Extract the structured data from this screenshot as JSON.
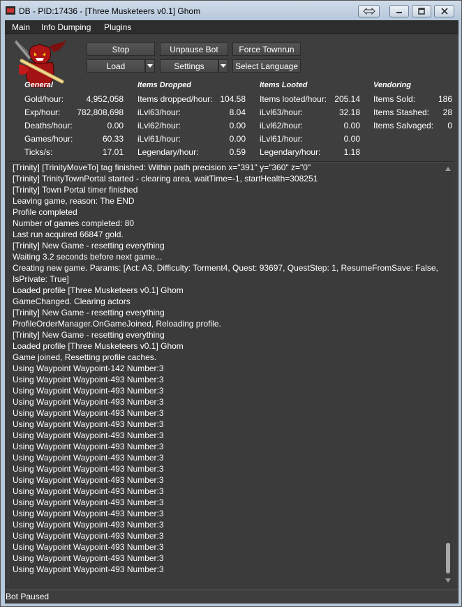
{
  "window": {
    "title": "DB - PID:17436 - [Three Musketeers v0.1] Ghom"
  },
  "menu": {
    "items": [
      "Main",
      "Info Dumping",
      "Plugins"
    ]
  },
  "buttons": {
    "stop": "Stop",
    "unpause": "Unpause Bot",
    "townrun": "Force Townrun",
    "load": "Load",
    "settings": "Settings",
    "language": "Select Language"
  },
  "stats": {
    "general": {
      "title": "General",
      "rows": [
        {
          "label": "Gold/hour:",
          "value": "4,952,058"
        },
        {
          "label": "Exp/hour:",
          "value": "782,808,698"
        },
        {
          "label": "Deaths/hour:",
          "value": "0.00"
        },
        {
          "label": "Games/hour:",
          "value": "60.33"
        },
        {
          "label": "Ticks/s:",
          "value": "17.01"
        }
      ]
    },
    "dropped": {
      "title": "Items Dropped",
      "rows": [
        {
          "label": "Items dropped/hour:",
          "value": "104.58"
        },
        {
          "label": "iLvl63/hour:",
          "value": "8.04"
        },
        {
          "label": "iLvl62/hour:",
          "value": "0.00"
        },
        {
          "label": "iLvl61/hour:",
          "value": "0.00"
        },
        {
          "label": "Legendary/hour:",
          "value": "0.59"
        }
      ]
    },
    "looted": {
      "title": "Items Looted",
      "rows": [
        {
          "label": "Items looted/hour:",
          "value": "205.14"
        },
        {
          "label": "iLvl63/hour:",
          "value": "32.18"
        },
        {
          "label": "iLvl62/hour:",
          "value": "0.00"
        },
        {
          "label": "iLvl61/hour:",
          "value": "0.00"
        },
        {
          "label": "Legendary/hour:",
          "value": "1.18"
        }
      ]
    },
    "vendoring": {
      "title": "Vendoring",
      "rows": [
        {
          "label": "Items Sold:",
          "value": "186"
        },
        {
          "label": "Items Stashed:",
          "value": "28"
        },
        {
          "label": "Items Salvaged:",
          "value": "0"
        }
      ]
    }
  },
  "log": [
    "[Trinity] [TrinityMoveTo] tag finished: Within path precision x=\"391\" y=\"360\" z=\"0\"",
    "[Trinity] TrinityTownPortal started - clearing area, waitTime=-1, startHealth=308251",
    "[Trinity] Town Portal timer finished",
    "Leaving game, reason: The END",
    "Profile completed",
    "Number of games completed: 80",
    "Last run acquired 66847 gold.",
    "[Trinity] New Game - resetting everything",
    "Waiting 3.2 seconds before next game...",
    "Creating new game. Params: [Act: A3, Difficulty: Torment4, Quest: 93697, QuestStep: 1, ResumeFromSave: False, IsPrivate: True]",
    "Loaded profile [Three Musketeers v0.1] Ghom",
    "GameChanged. Clearing actors",
    "[Trinity] New Game - resetting everything",
    "ProfileOrderManager.OnGameJoined, Reloading profile.",
    "[Trinity] New Game - resetting everything",
    "Loaded profile [Three Musketeers v0.1] Ghom",
    "Game joined, Resetting profile caches.",
    "Using Waypoint Waypoint-142 Number:3",
    "Using Waypoint Waypoint-493 Number:3",
    "Using Waypoint Waypoint-493 Number:3",
    "Using Waypoint Waypoint-493 Number:3",
    "Using Waypoint Waypoint-493 Number:3",
    "Using Waypoint Waypoint-493 Number:3",
    "Using Waypoint Waypoint-493 Number:3",
    "Using Waypoint Waypoint-493 Number:3",
    "Using Waypoint Waypoint-493 Number:3",
    "Using Waypoint Waypoint-493 Number:3",
    "Using Waypoint Waypoint-493 Number:3",
    "Using Waypoint Waypoint-493 Number:3",
    "Using Waypoint Waypoint-493 Number:3",
    "Using Waypoint Waypoint-493 Number:3",
    "Using Waypoint Waypoint-493 Number:3",
    "Using Waypoint Waypoint-493 Number:3",
    "Using Waypoint Waypoint-493 Number:3",
    "Using Waypoint Waypoint-493 Number:3",
    "Using Waypoint Waypoint-493 Number:3"
  ],
  "status": {
    "text": "Bot Paused"
  },
  "icons": {
    "app": "app-icon",
    "logo": "demon-logo",
    "restore": "restore-arrows-icon",
    "minimize": "minimize-icon",
    "maximize": "maximize-icon",
    "close": "close-icon",
    "dropdown": "chevron-down-icon",
    "scroll_up": "scroll-up-icon",
    "scroll_down": "scroll-down-icon"
  }
}
